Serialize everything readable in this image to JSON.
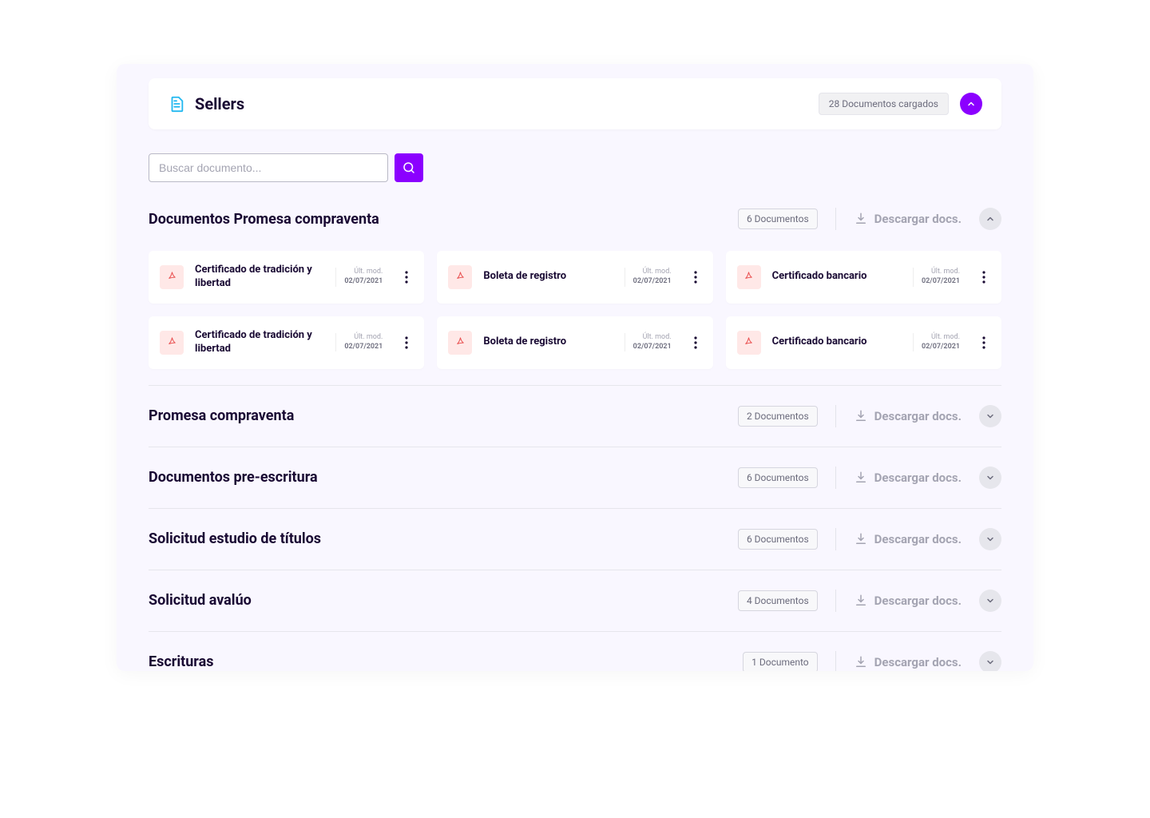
{
  "header": {
    "title": "Sellers",
    "doc_count_badge": "28 Documentos cargados"
  },
  "search": {
    "placeholder": "Buscar documento..."
  },
  "meta": {
    "last_mod_label": "Últ. mod.",
    "download_label": "Descargar docs."
  },
  "expanded_section": {
    "title": "Documentos Promesa compraventa",
    "doc_badge": "6 Documentos",
    "documents": [
      {
        "name": "Certificado de tradición y libertad",
        "date": "02/07/2021"
      },
      {
        "name": "Boleta de registro",
        "date": "02/07/2021"
      },
      {
        "name": "Certificado bancario",
        "date": "02/07/2021"
      },
      {
        "name": "Certificado de tradición y libertad",
        "date": "02/07/2021"
      },
      {
        "name": "Boleta de registro",
        "date": "02/07/2021"
      },
      {
        "name": "Certificado bancario",
        "date": "02/07/2021"
      }
    ]
  },
  "collapsed_sections": [
    {
      "title": "Promesa compraventa",
      "doc_badge": "2 Documentos"
    },
    {
      "title": "Documentos pre-escritura",
      "doc_badge": "6 Documentos"
    },
    {
      "title": "Solicitud estudio de títulos",
      "doc_badge": "6 Documentos"
    },
    {
      "title": "Solicitud avalúo",
      "doc_badge": "4 Documentos"
    },
    {
      "title": "Escrituras",
      "doc_badge": "1 Documento"
    }
  ]
}
